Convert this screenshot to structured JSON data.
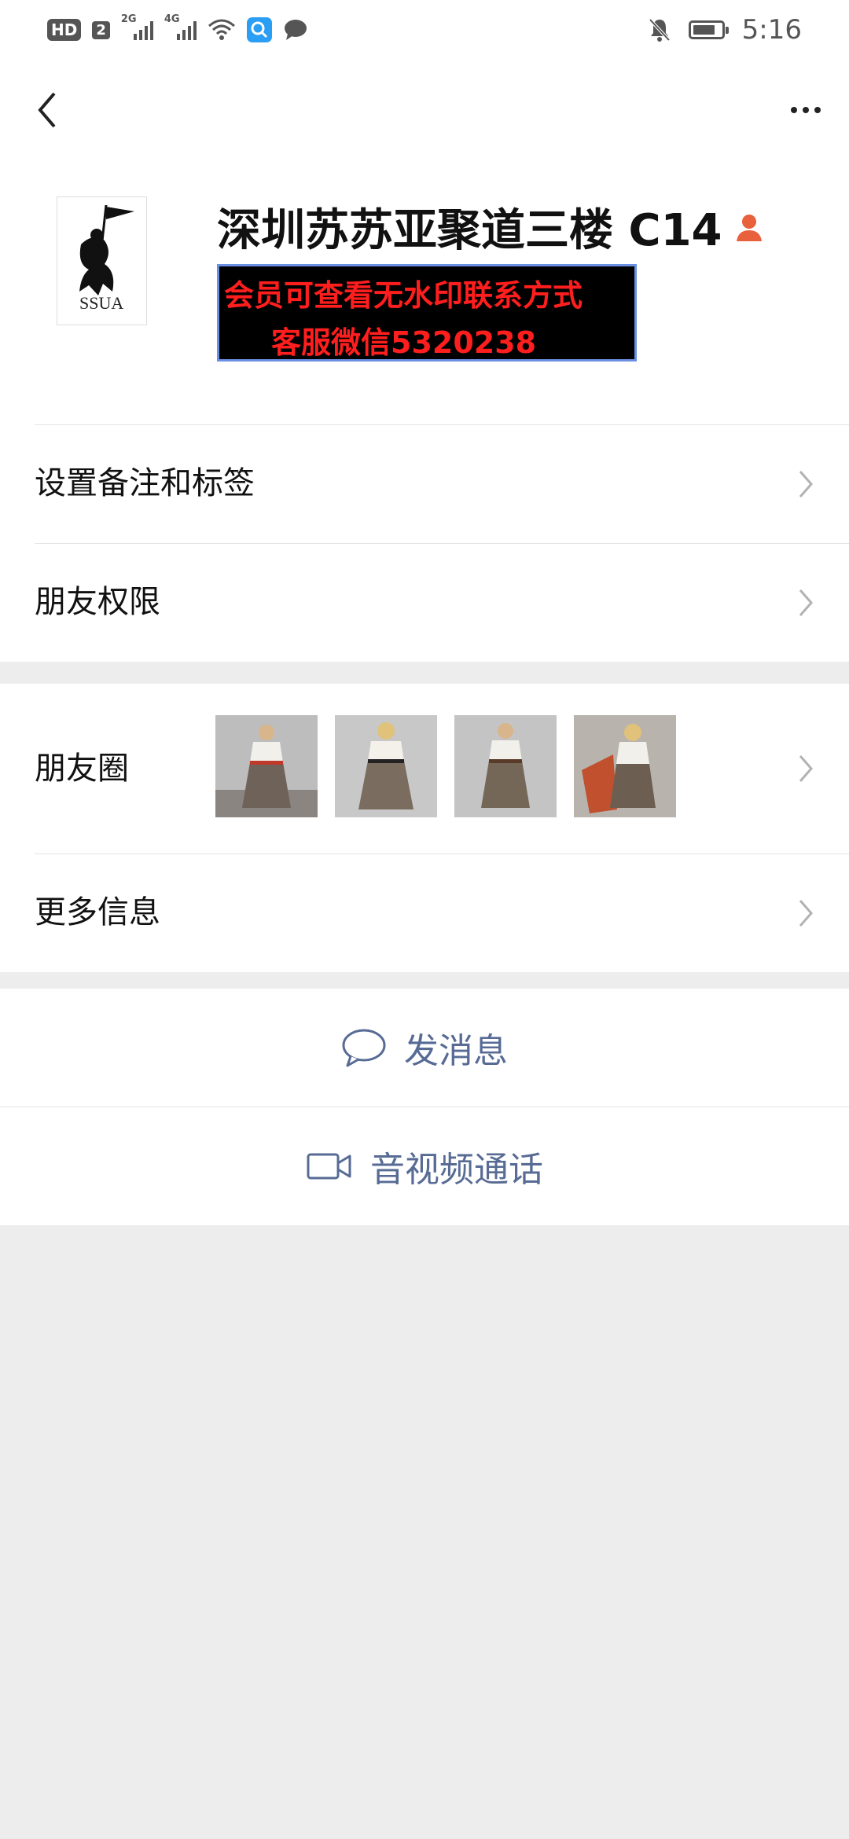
{
  "status_bar": {
    "hd": "HD",
    "sim_slot": "2",
    "net1": "2G",
    "net2": "4G",
    "time": "5:16",
    "battery_level": 0.8,
    "icons": [
      "hd-icon",
      "signal-icon",
      "wifi-icon",
      "search-app-icon",
      "message-icon",
      "mute-bell-icon",
      "battery-icon"
    ]
  },
  "navbar": {
    "back_icon": "chevron-left-icon",
    "more_icon": "ellipsis-icon"
  },
  "profile": {
    "name": "深圳苏苏亚聚道三楼 C14",
    "avatar_text": "SSUA",
    "promo_line1": "会员可查看无水印联系方式",
    "promo_line2": "客服微信5320238"
  },
  "settings": {
    "remark_label": "设置备注和标签",
    "permission_label": "朋友权限"
  },
  "moments": {
    "label": "朋友圈",
    "more_label": "更多信息"
  },
  "actions": {
    "message_label": "发消息",
    "call_label": "音视频通话"
  },
  "colors": {
    "link": "#576b95",
    "promo_text": "#ff1e1e",
    "promo_border": "#6b8fe3",
    "background": "#ededed",
    "badge_orange": "#e8603c"
  }
}
